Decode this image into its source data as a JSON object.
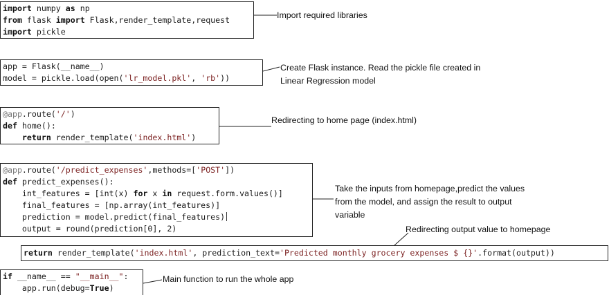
{
  "blocks": {
    "imports": {
      "lines": [
        "import numpy as np",
        "from flask import Flask,render_template,request",
        "import pickle"
      ],
      "note": "Import required libraries"
    },
    "app_init": {
      "line1_a": "app = Flask(__name__)",
      "line2_a": "model = pickle.load(open(",
      "line2_str1": "'lr_model.pkl'",
      "line2_b": ", ",
      "line2_str2": "'rb'",
      "line2_c": "))",
      "note_line1": "Create Flask instance. Read the pickle file created in",
      "note_line2": "Linear Regression model"
    },
    "home_route": {
      "decorator": "@app",
      "route_rest": ".route(",
      "route_str": "'/'",
      "route_end": ")",
      "def_kw": "def",
      "def_rest": " home():",
      "return_kw": "return",
      "return_rest": " render_template(",
      "return_str": "'index.html'",
      "return_end": ")",
      "note": "Redirecting to home page (index.html)"
    },
    "predict_route": {
      "decorator": "@app",
      "route_rest": ".route(",
      "route_str1": "'/predict_expenses'",
      "route_mid": ",methods=[",
      "route_str2": "'POST'",
      "route_end": "])",
      "def_kw": "def",
      "def_rest": " predict_expenses():",
      "line3_a": "int_features = [int(x) ",
      "line3_for": "for",
      "line3_b": " x ",
      "line3_in": "in",
      "line3_c": " request.form.values()]",
      "line4": "final_features = [np.array(int_features)]",
      "line5": "prediction = model.predict(final_features)",
      "line6": "output = round(prediction[0], 2)",
      "note_line1": "Take the inputs from homepage,predict the values",
      "note_line2": "from the model, and assign the result to output",
      "note_line3": "variable"
    },
    "return_line": {
      "return_kw": "return",
      "rest_a": " render_template(",
      "str1": "'index.html'",
      "rest_b": ", prediction_text=",
      "str2": "'Predicted monthly grocery expenses $ {}'",
      "rest_c": ".format(output))",
      "note": "Redirecting output value to homepage"
    },
    "main_block": {
      "if_kw": "if",
      "if_rest_a": " __name__ == ",
      "if_str": "\"__main__\"",
      "if_rest_b": ":",
      "run_a": "app.run(debug=",
      "run_kw": "True",
      "run_b": ")",
      "note": "Main function to run the whole app"
    }
  }
}
